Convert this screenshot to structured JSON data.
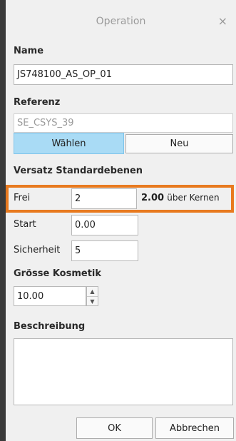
{
  "dialog": {
    "title": "Operation",
    "close_glyph": "×"
  },
  "name": {
    "label": "Name",
    "value": "JS748100_AS_OP_01"
  },
  "referenz": {
    "label": "Referenz",
    "value": "SE_CSYS_39",
    "select_label": "Wählen",
    "new_label": "Neu"
  },
  "offsets": {
    "label": "Versatz Standardebenen",
    "frei_label": "Frei",
    "frei_value": "2",
    "frei_computed": "2.00",
    "frei_suffix": "über Kernen",
    "start_label": "Start",
    "start_value": "0.00",
    "sicherheit_label": "Sicherheit",
    "sicherheit_value": "5"
  },
  "kosmetik": {
    "label": "Grösse Kosmetik",
    "value": "10.00",
    "up_glyph": "▲",
    "down_glyph": "▼"
  },
  "beschreibung": {
    "label": "Beschreibung",
    "value": ""
  },
  "footer": {
    "ok_label": "OK",
    "cancel_label": "Abbrechen"
  },
  "colors": {
    "highlight": "#e87a1f",
    "active_button": "#a9dbf5"
  }
}
